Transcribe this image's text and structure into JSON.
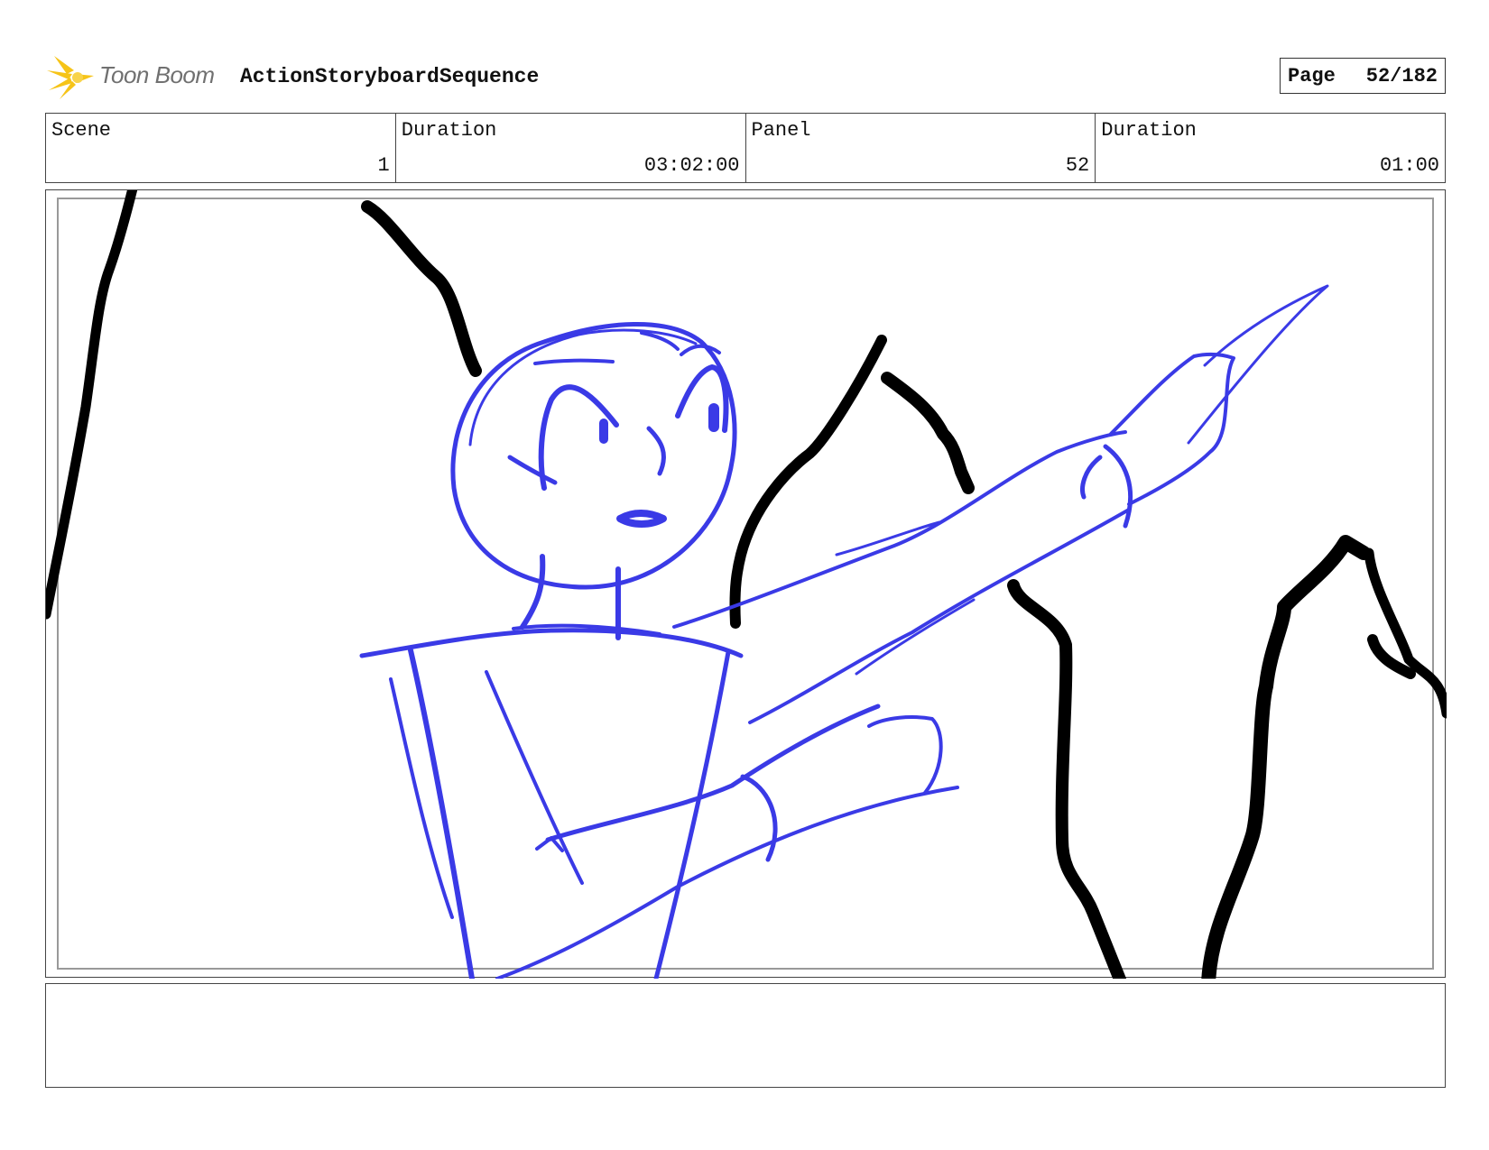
{
  "header": {
    "logo_text": "Toon Boom",
    "sequence_title": "ActionStoryboardSequence",
    "page_label": "Page",
    "page_value": "52/182"
  },
  "info": {
    "scene_label": "Scene",
    "scene_value": "1",
    "scene_duration_label": "Duration",
    "scene_duration_value": "03:02:00",
    "panel_label": "Panel",
    "panel_value": "52",
    "panel_duration_label": "Duration",
    "panel_duration_value": "01:00"
  },
  "notes": {
    "text": ""
  },
  "colors": {
    "sketch_blue": "#3a3ae6",
    "sketch_black": "#000000",
    "logo_yellow": "#f6c418"
  }
}
